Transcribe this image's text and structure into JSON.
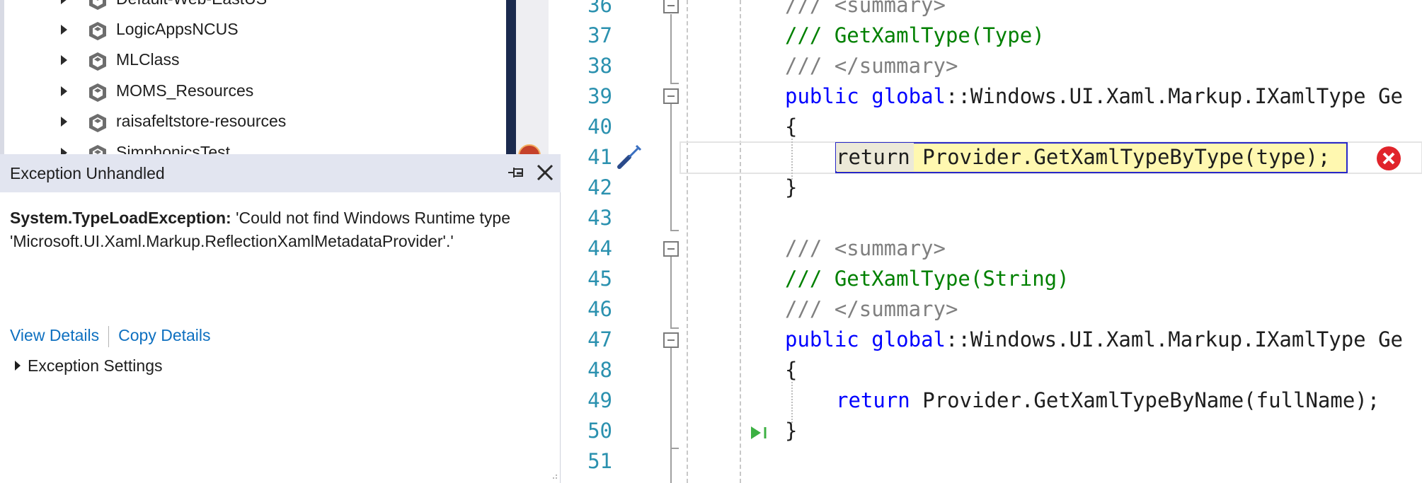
{
  "tree": {
    "items": [
      {
        "label": "Default-Web-EastUS"
      },
      {
        "label": "LogicAppsNCUS"
      },
      {
        "label": "MLClass"
      },
      {
        "label": "MOMS_Resources"
      },
      {
        "label": "raisafeltstore-resources"
      },
      {
        "label": "SimphonicsTest"
      }
    ]
  },
  "exception": {
    "title": "Exception Unhandled",
    "type": "System.TypeLoadException:",
    "message": " 'Could not find Windows Runtime type 'Microsoft.UI.Xaml.Markup.ReflectionXamlMetadataProvider'.'",
    "view_details": "View Details",
    "copy_details": "Copy Details",
    "settings": "Exception Settings"
  },
  "editor": {
    "lines": [
      {
        "num": "36",
        "text": "/// <summary>"
      },
      {
        "num": "37",
        "text": "/// GetXamlType(Type)"
      },
      {
        "num": "38",
        "text": "/// </summary>"
      },
      {
        "num": "39",
        "kw1": "public",
        "kw2": "global",
        "rest": "::Windows.UI.Xaml.Markup.IXamlType Ge"
      },
      {
        "num": "40",
        "text": "{"
      },
      {
        "num": "41",
        "kw": "return",
        "rest": " Provider.GetXamlTypeByType(type);"
      },
      {
        "num": "42",
        "text": "}"
      },
      {
        "num": "43",
        "text": ""
      },
      {
        "num": "44",
        "text": "/// <summary>"
      },
      {
        "num": "45",
        "text": "/// GetXamlType(String)"
      },
      {
        "num": "46",
        "text": "/// </summary>"
      },
      {
        "num": "47",
        "kw1": "public",
        "kw2": "global",
        "rest": "::Windows.UI.Xaml.Markup.IXamlType Ge"
      },
      {
        "num": "48",
        "text": "{"
      },
      {
        "num": "49",
        "kw": "return",
        "rest": " Provider.GetXamlTypeByName(fullName);"
      },
      {
        "num": "50",
        "text": "}"
      },
      {
        "num": "51",
        "text": ""
      }
    ]
  },
  "colors": {
    "keyword": "#0000ff",
    "comment": "#008000",
    "line_number": "#2b91af",
    "link": "#0e70c0",
    "error": "#e0242b"
  },
  "icons": {
    "tree_node": "resource-group-icon",
    "pin": "pin-icon",
    "close": "close-icon",
    "error": "error-icon",
    "tool": "screwdriver-icon",
    "run_to_click": "run-to-click-icon"
  }
}
